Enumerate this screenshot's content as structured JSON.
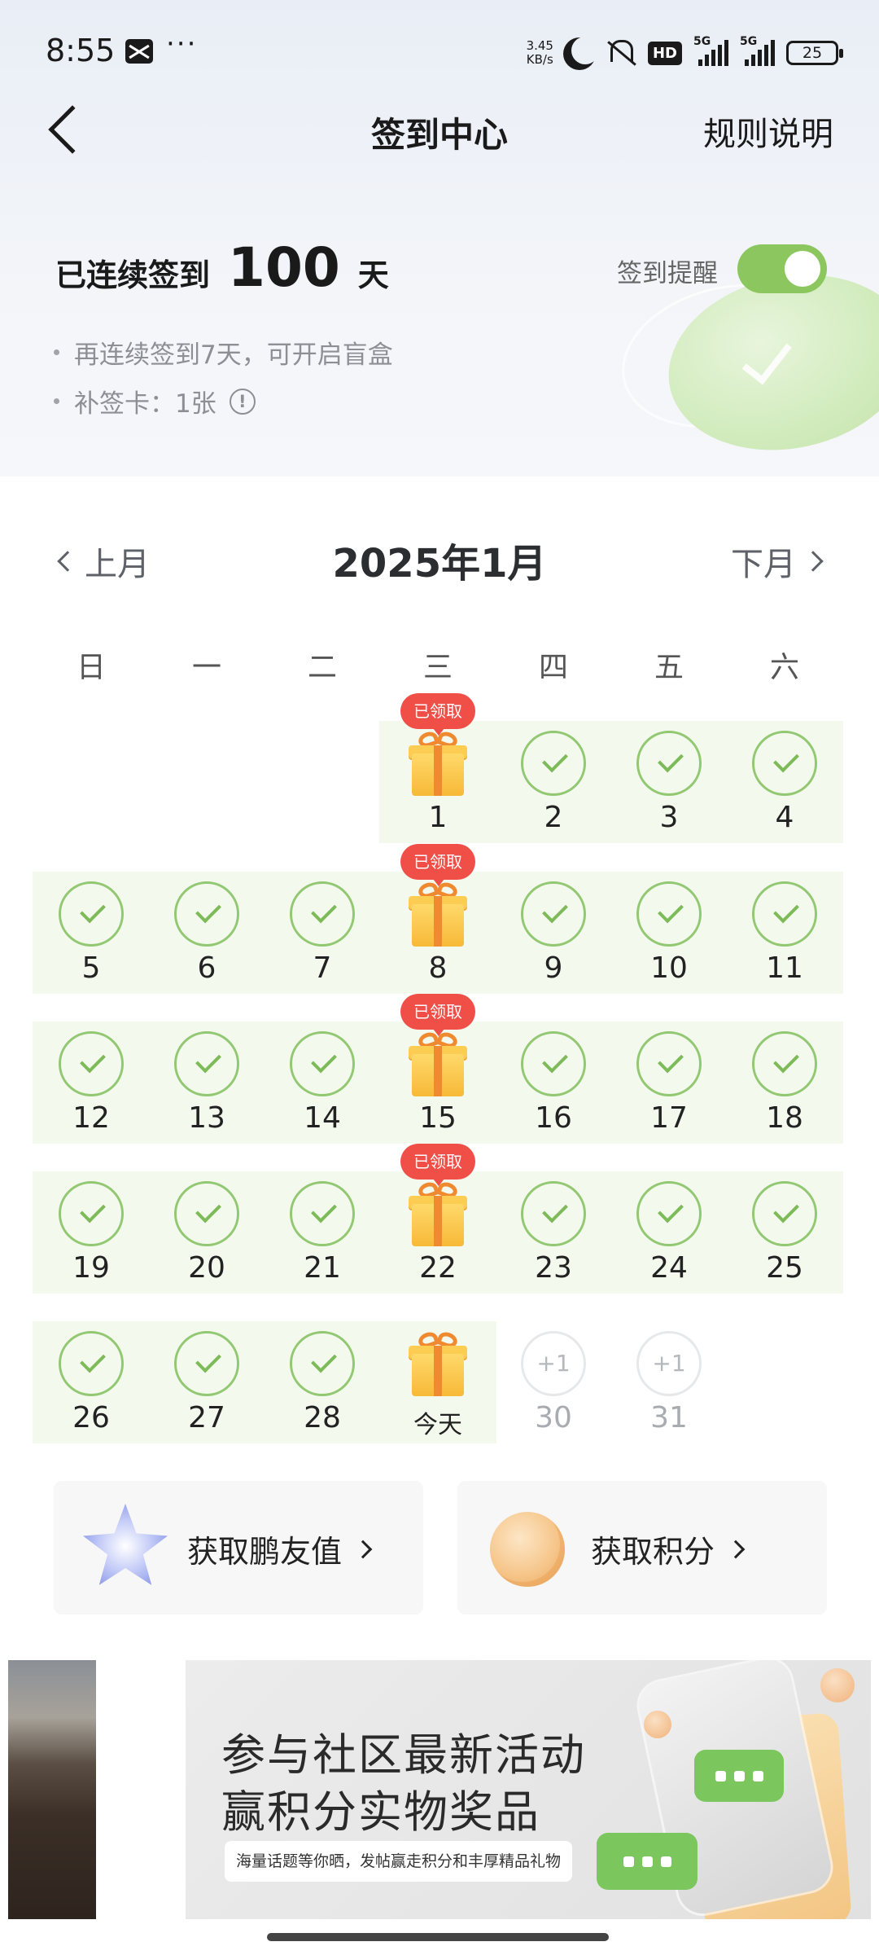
{
  "status_bar": {
    "time": "8:55",
    "dots": "···",
    "speed_value": "3.45",
    "speed_unit": "KB/s",
    "hd": "HD",
    "signal1": "5G",
    "signal2": "5G",
    "battery": "25"
  },
  "nav": {
    "title": "签到中心",
    "rules": "规则说明"
  },
  "streak": {
    "prefix": "已连续签到",
    "days": "100",
    "suffix": "天",
    "hint1": "再连续签到7天，可开启盲盒",
    "hint2": "补签卡：1张",
    "info_icon": "!",
    "reminder_label": "签到提醒",
    "reminder_on": true
  },
  "calendar": {
    "prev": "上月",
    "title": "2025年1月",
    "next": "下月",
    "weekdays": [
      "日",
      "一",
      "二",
      "三",
      "四",
      "五",
      "六"
    ],
    "claimed_label": "已领取",
    "today_label": "今天",
    "bonus_label": "+1",
    "days": {
      "1": "1",
      "2": "2",
      "3": "3",
      "4": "4",
      "5": "5",
      "6": "6",
      "7": "7",
      "8": "8",
      "9": "9",
      "10": "10",
      "11": "11",
      "12": "12",
      "13": "13",
      "14": "14",
      "15": "15",
      "16": "16",
      "17": "17",
      "18": "18",
      "19": "19",
      "20": "20",
      "21": "21",
      "22": "22",
      "23": "23",
      "24": "24",
      "25": "25",
      "26": "26",
      "27": "27",
      "28": "28",
      "30": "30",
      "31": "31"
    },
    "signed_days": [
      2,
      3,
      4,
      5,
      6,
      7,
      9,
      10,
      11,
      12,
      13,
      14,
      16,
      17,
      18,
      19,
      20,
      21,
      23,
      24,
      25,
      26,
      27,
      28
    ],
    "gift_claimed_days": [
      1,
      8,
      15,
      22
    ],
    "today_day": 29,
    "future_days": [
      30,
      31
    ]
  },
  "cards": {
    "friend": {
      "label": "获取鹏友值",
      "icon": "star-icon"
    },
    "points": {
      "label": "获取积分",
      "icon": "coin-icon"
    }
  },
  "banner": {
    "line1": "参与社区最新活动",
    "line2": "赢积分实物奖品",
    "sub": "海量话题等你晒，发帖赢走积分和丰厚精品礼物"
  },
  "colors": {
    "accent_green": "#8bc75e",
    "claimed_red": "#ef4f47",
    "gift_orange": "#f08a31"
  }
}
